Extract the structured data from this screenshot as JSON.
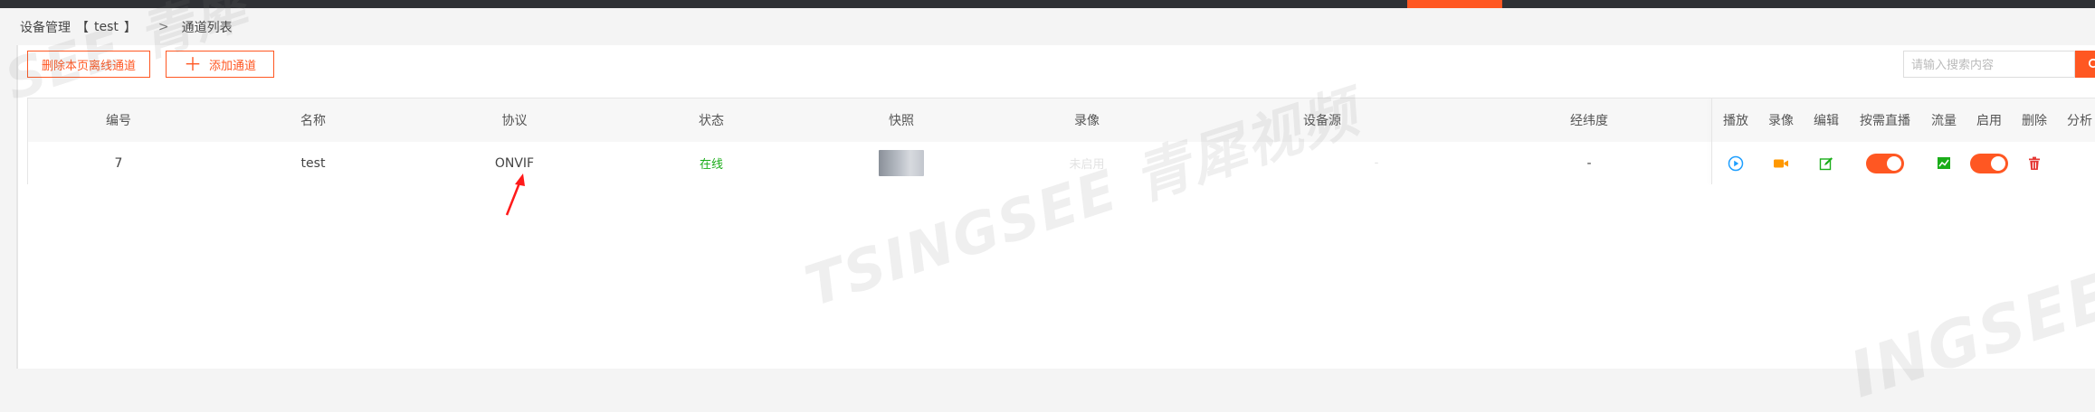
{
  "breadcrumb": {
    "device_manage": "设备管理",
    "bracket_open": "【",
    "device_name": "test",
    "bracket_close": "】",
    "separator": ">",
    "current": "通道列表"
  },
  "toolbar": {
    "delete_offline_label": "删除本页离线通道",
    "add_channel_label": "添加通道",
    "add_icon": "plus-icon"
  },
  "search": {
    "placeholder": "请输入搜索内容",
    "value": "",
    "icon": "search-icon"
  },
  "table": {
    "columns": [
      "编号",
      "名称",
      "协议",
      "状态",
      "快照",
      "录像",
      "设备源",
      "经纬度"
    ],
    "action_columns": [
      "播放",
      "录像",
      "编辑",
      "按需直播",
      "流量",
      "启用",
      "删除",
      "分析"
    ],
    "rows": [
      {
        "id": "7",
        "name": "test",
        "protocol": "ONVIF",
        "status": "在线",
        "snapshot": "snapshot-thumbnail",
        "record": "未启用",
        "source": "-",
        "latlng": "-",
        "actions": {
          "play": "play-circle-icon",
          "record": "video-camera-icon",
          "edit": "edit-icon",
          "on_demand": true,
          "flow": "traffic-chart-icon",
          "enabled": true,
          "delete": "trash-icon"
        }
      }
    ]
  },
  "watermark": {
    "text": "TSINGSEE 青犀视频",
    "partial_left": "SEE 青犀",
    "partial_right": "INGSEE"
  },
  "colors": {
    "accent": "#ff5722",
    "online": "#1aad19",
    "topbar": "#2f3135",
    "play_icon": "#1e9fff",
    "record_icon": "#ff9800",
    "edit_icon": "#1aad19"
  }
}
